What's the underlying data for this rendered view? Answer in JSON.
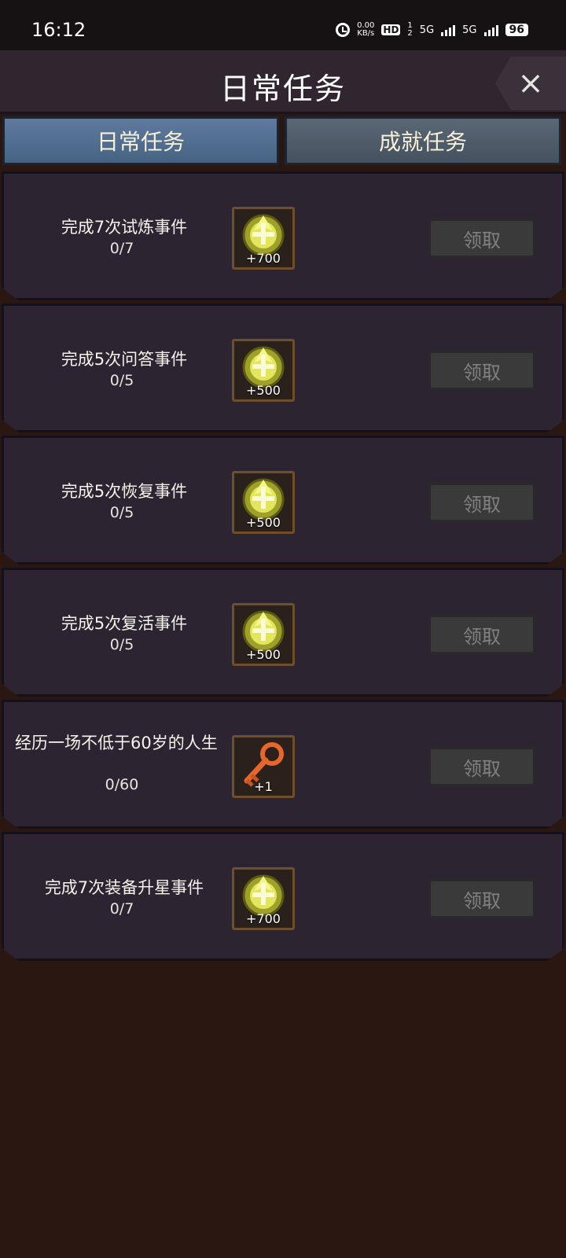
{
  "status_bar": {
    "time": "16:12",
    "net_speed": "0.00",
    "net_unit": "KB/s",
    "hd": "HD",
    "hd_sub": "1",
    "hd_sub2": "2",
    "sig1": "5G",
    "sig2": "5G",
    "battery": "96"
  },
  "header": {
    "title": "日常任务",
    "close_icon": "×"
  },
  "tabs": [
    {
      "label": "日常任务",
      "active": true
    },
    {
      "label": "成就任务",
      "active": false
    }
  ],
  "tasks": [
    {
      "title": "完成7次试炼事件",
      "progress": "0/7",
      "reward_icon": "gold-crest-icon",
      "reward_amount": "+700",
      "button": "领取"
    },
    {
      "title": "完成5次问答事件",
      "progress": "0/5",
      "reward_icon": "gold-crest-icon",
      "reward_amount": "+500",
      "button": "领取"
    },
    {
      "title": "完成5次恢复事件",
      "progress": "0/5",
      "reward_icon": "gold-crest-icon",
      "reward_amount": "+500",
      "button": "领取"
    },
    {
      "title": "完成5次复活事件",
      "progress": "0/5",
      "reward_icon": "gold-crest-icon",
      "reward_amount": "+500",
      "button": "领取"
    },
    {
      "title": "经历一场不低于60岁的人生",
      "progress": "0/60",
      "reward_icon": "key-icon",
      "reward_amount": "+1",
      "button": "领取"
    },
    {
      "title": "完成7次装备升星事件",
      "progress": "0/7",
      "reward_icon": "gold-crest-icon",
      "reward_amount": "+700",
      "button": "领取"
    }
  ],
  "colors": {
    "accent_tab": "#5f7a9e",
    "card_bg": "#2c2431",
    "page_bg": "#2a1712",
    "disabled_button": "#3a3a3a"
  }
}
